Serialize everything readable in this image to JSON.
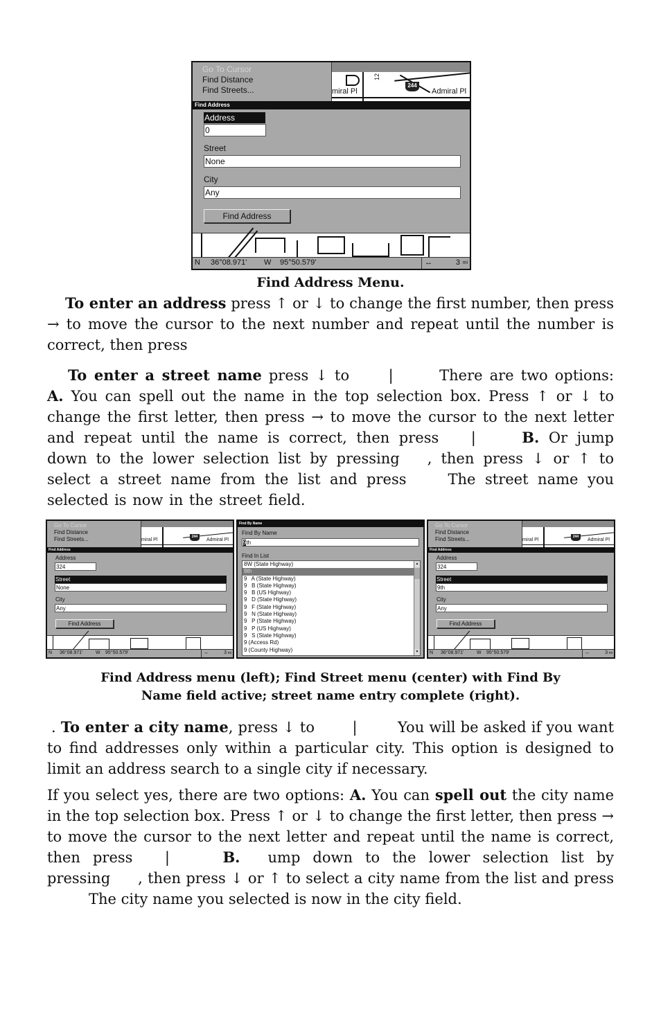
{
  "figure1": {
    "menu": {
      "items": [
        {
          "label": "Go To Cursor",
          "disabled": true
        },
        {
          "label": "Find Distance"
        },
        {
          "label": "Find Streets..."
        }
      ]
    },
    "map_labels": {
      "street_partial": "miral Pl",
      "street": "Admiral Pl",
      "highway_shield": "244",
      "road_number": "12"
    },
    "dialog_title": "Find Address",
    "address_label": "Address",
    "address_value": "0",
    "street_label": "Street",
    "street_value": "None",
    "city_label": "City",
    "city_value": "Any",
    "find_button": "Find Address",
    "status": {
      "lat_hemi": "N",
      "lat": "36°08.971'",
      "lon_hemi": "W",
      "lon": "95°50.579'",
      "scale_icon": "↔",
      "scale_value": "3",
      "scale_unit": "mi"
    },
    "caption": "Find Address Menu."
  },
  "para1": {
    "bold": "To enter an address",
    "line1": " press ↑ or ↓ to change the first number, then press → to move the cursor to the next number and repeat until the number is correct, then press"
  },
  "para2": {
    "bold": "To enter a street name",
    "t1": " press ↓ to",
    "pipe": "|",
    "t2": "There are two options: ",
    "a": "A.",
    "t3": " You can spell out the name in the top selection box. Press ↑ or ↓ to change the first letter, then press → to move the cursor to the next letter and repeat until the name is correct, then press",
    "b": "B.",
    "t4": "Or jump down to the lower selection list by pressing",
    "t5": ", then press ↓ or ↑ to select a street name from the list and press",
    "t6": "The street name you selected is now in the street field."
  },
  "fig_left": {
    "menu": [
      "Go To Cursor",
      "Find Distance",
      "Find Streets..."
    ],
    "dialog_title": "Find Address",
    "address_label": "Address",
    "address_value": "324",
    "street_label": "Street",
    "street_value": "None",
    "city_label": "City",
    "city_value": "Any",
    "find_button": "Find Address",
    "map_label": "Admiral Pl",
    "map_label_partial": "miral Pl",
    "shield": "244",
    "status": {
      "lat_hemi": "N",
      "lat": "36°08.971'",
      "lon_hemi": "W",
      "lon": "95°50.579'",
      "scale_icon": "↔",
      "scale_value": "3",
      "scale_unit": "mi"
    }
  },
  "fig_center": {
    "dialog_title": "Find By Name",
    "find_by_name_label": "Find By Name",
    "find_by_name_cursor": "9",
    "find_by_name_rest": "th",
    "find_in_list_label": "Find In List",
    "list": [
      "8W (State Highway)",
      "9th",
      "9   A (State Highway)",
      "9   B (State Highway)",
      "9   B (US Highway)",
      "9   D (State Highway)",
      "9   F (State Highway)",
      "9   N (State Highway)",
      "9   P (State Highway)",
      "9   P (US Highway)",
      "9   S (State Highway)",
      "9 (Access Rd)",
      "9 (County Highway)"
    ],
    "selected_index": 1,
    "scroll_up": "▲",
    "scroll_down": "▼"
  },
  "fig_right": {
    "menu": [
      "Go To Cursor",
      "Find Distance",
      "Find Streets..."
    ],
    "dialog_title": "Find Address",
    "address_label": "Address",
    "address_value": "324",
    "street_label": "Street",
    "street_value": "9th",
    "city_label": "City",
    "city_value": "Any",
    "find_button": "Find Address",
    "map_label": "Admiral Pl",
    "map_label_partial": "miral Pl",
    "shield": "244",
    "status": {
      "lat_hemi": "N",
      "lat": "36°08.971'",
      "lon_hemi": "W",
      "lon": "95°50.579'",
      "scale_icon": "↔",
      "scale_value": "3",
      "scale_unit": "mi"
    }
  },
  "caption2": {
    "line1": "Find Address menu (left); Find Street menu (center) with Find By",
    "line2": "Name field active; street name entry complete (right)."
  },
  "para3": {
    "lead": ". ",
    "bold": "To enter a city name",
    "t1": ", press ↓ to",
    "pipe": "|",
    "t2": "You will be asked if you want to find addresses only within a particular city. This option is designed to limit an address search to a single city if necessary."
  },
  "para4": {
    "t1": "If you select yes, there are two options: ",
    "a": "A.",
    "t2": " You can ",
    "spell": "spell out",
    "t3": " the city name in the top selection box. Press ↑ or ↓ to change the first letter, then press → to move the cursor to the next letter and repeat until the name is correct, then press",
    "pipe": "|",
    "b": "B.",
    "t4": "ump down to the lower selection list by pressing",
    "t5": ", then press ↓ or ↑ to select a city name from the list and press",
    "t6": "The city name you selected is now in the city field."
  }
}
